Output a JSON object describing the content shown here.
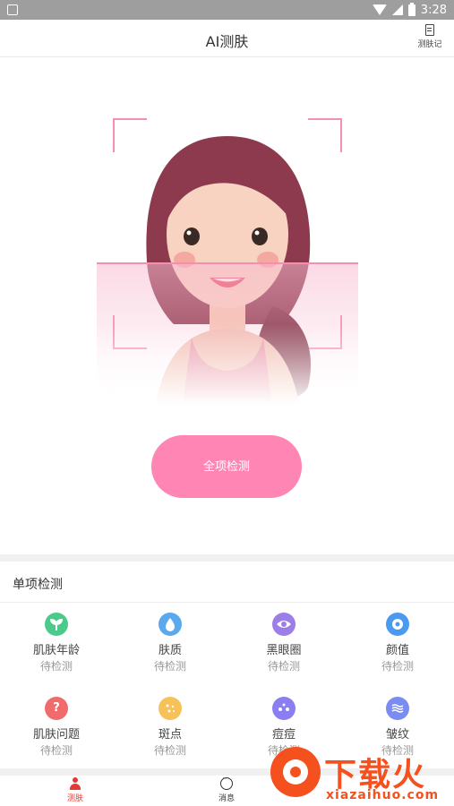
{
  "status_bar": {
    "time": "3:28"
  },
  "header": {
    "title": "AI测肤",
    "record_label": "测肤记"
  },
  "scan": {
    "button_label": "全项检测"
  },
  "single_detect": {
    "title": "单项检测",
    "items": [
      {
        "name": "肌肤年龄",
        "status": "待检测",
        "icon": "sprout-icon",
        "color": "#4cca8c"
      },
      {
        "name": "肤质",
        "status": "待检测",
        "icon": "water-drop-icon",
        "color": "#5aa8ee"
      },
      {
        "name": "黑眼圈",
        "status": "待检测",
        "icon": "eye-icon",
        "color": "#9b7ee8"
      },
      {
        "name": "颜值",
        "status": "待检测",
        "icon": "flower-icon",
        "color": "#4a9af0"
      },
      {
        "name": "肌肤问题",
        "status": "待检测",
        "icon": "question-icon",
        "color": "#f06b6b"
      },
      {
        "name": "斑点",
        "status": "待检测",
        "icon": "dots-icon",
        "color": "#f7c15a"
      },
      {
        "name": "痘痘",
        "status": "待检测",
        "icon": "pimple-icon",
        "color": "#8a7ef0"
      },
      {
        "name": "皱纹",
        "status": "待检测",
        "icon": "wrinkle-icon",
        "color": "#7a8cf0"
      }
    ]
  },
  "tabbar": {
    "tabs": [
      {
        "label": "测肤",
        "active": true
      },
      {
        "label": "消息",
        "active": false
      }
    ]
  },
  "watermark": {
    "text": "下载火",
    "sub": "xiazaihuo.com"
  },
  "colors": {
    "accent": "#ff85b4",
    "scan_frame": "#f48fb1",
    "active_tab": "#e53935"
  }
}
